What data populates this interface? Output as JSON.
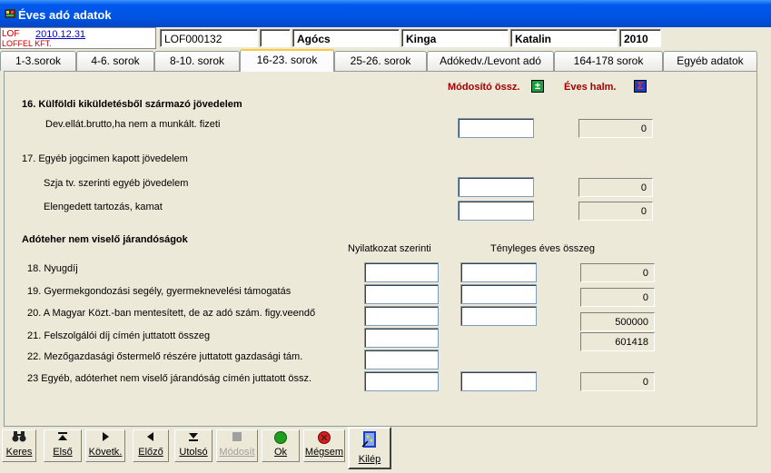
{
  "window": {
    "title": "Éves adó adatok"
  },
  "header": {
    "code": "LOF",
    "date": "2010.12.31",
    "company": "LOFFEL KFT.",
    "id": "LOF000132",
    "empty": "",
    "last_name": "Agócs",
    "first_name": "Kinga",
    "middle_name": "Katalin",
    "year": "2010"
  },
  "tabs": [
    {
      "label": "1-3.sorok"
    },
    {
      "label": "4-6. sorok"
    },
    {
      "label": "8-10. sorok"
    },
    {
      "label": "16-23. sorok"
    },
    {
      "label": "25-26. sorok"
    },
    {
      "label": "Adókedv./Levont adó"
    },
    {
      "label": "164-178 sorok"
    },
    {
      "label": "Egyéb adatok"
    }
  ],
  "active_tab": 3,
  "form": {
    "modosito_label": "Módosító össz.",
    "eves_halm_label": "Éves halm.",
    "section16_title": "16. Külföldi kiküldetésből származó jövedelem",
    "row_dev_label": "Dev.ellát.brutto,ha nem a munkált. fizeti",
    "row_dev_value": "0",
    "section17_title": "17. Egyéb jogcimen kapott jövedelem",
    "row_szja_label": "Szja tv. szerinti egyéb jövedelem",
    "row_szja_value": "0",
    "row_elengedett_label": "Elengedett tartozás, kamat",
    "row_elengedett_value": "0",
    "section_adoteher_title": "Adóteher nem viselő járandóságok",
    "col_nyilatkozat": "Nyilatkozat szerinti",
    "col_tenyleges": "Tényleges éves összeg",
    "row18_label": "18. Nyugdíj",
    "row18_value": "0",
    "row19_label": "19. Gyermekgondozási segély, gyermeknevelési támogatás",
    "row19_value": "0",
    "row20_label": "20. A Magyar Közt.-ban mentesített, de az adó szám. figy.veendő",
    "row20_value": "500000",
    "row21_label": "21. Felszolgálói díj címén juttatott összeg",
    "row21_value": "601418",
    "row22_label": "22. Mezőgazdasági őstermelő részére juttatott gazdasági tám.",
    "row23_label": "23 Egyéb, adóterhet nem viselő járandóság címén juttatott össz.",
    "row23_value": "0"
  },
  "toolbar": {
    "keres": "Keres",
    "elso": "Első",
    "kovetk": "Követk.",
    "elozo": "Előző",
    "utolso": "Utolsó",
    "modosit": "Módosít",
    "ok": "Ok",
    "megsem": "Mégsem",
    "kilep": "Kilép"
  },
  "colors": {
    "title_blue": "#0054E3",
    "accent_red": "#A00000",
    "icon_green": "#1E9E1E",
    "icon_red": "#D81E1E"
  },
  "icons": [
    "binoculars-icon",
    "first-record-icon",
    "next-record-icon",
    "previous-record-icon",
    "last-record-icon",
    "modify-icon",
    "ok-icon",
    "cancel-icon",
    "exit-icon"
  ]
}
